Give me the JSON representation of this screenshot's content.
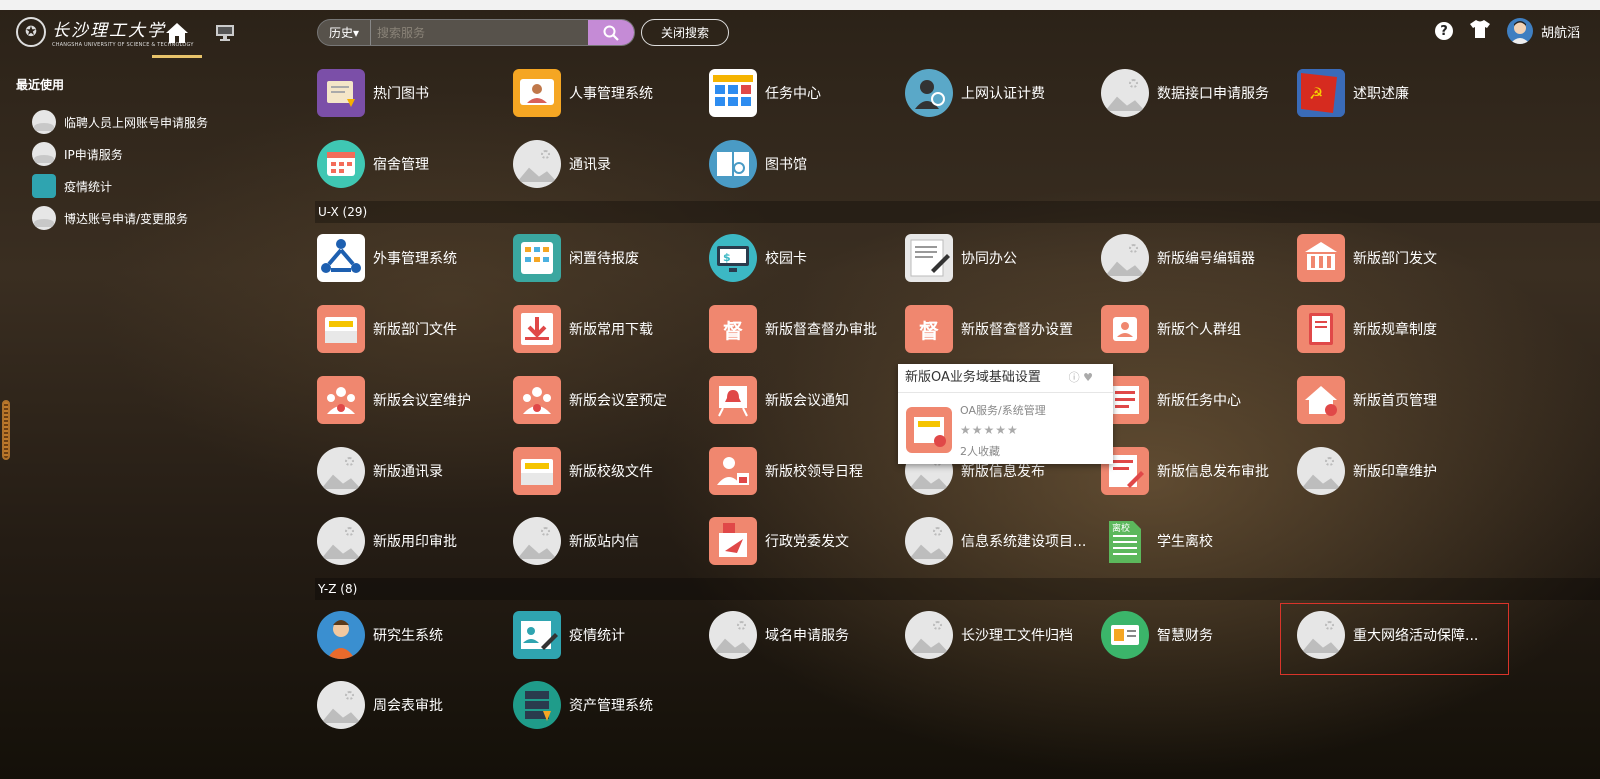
{
  "header": {
    "logo_cn": "长沙理工大学",
    "logo_en": "CHANGSHA UNIVERSITY OF SCIENCE & TECHNOLOGY",
    "history_label": "历史▾",
    "search_placeholder": "搜索服务",
    "close_search_label": "关闭搜索",
    "help_label": "?",
    "username": "胡航滔"
  },
  "sidebar": {
    "title": "最近使用",
    "items": [
      {
        "label": "临聘人员上网账号申请服务"
      },
      {
        "label": "IP申请服务"
      },
      {
        "label": "疫情统计"
      },
      {
        "label": "博达账号申请/变更服务"
      }
    ]
  },
  "sections": {
    "ux": "U-X (29)",
    "yz": "Y-Z (8)"
  },
  "apps": [
    {
      "label": "热门图书"
    },
    {
      "label": "人事管理系统"
    },
    {
      "label": "任务中心"
    },
    {
      "label": "上网认证计费"
    },
    {
      "label": "数据接口申请服务"
    },
    {
      "label": "述职述廉"
    },
    {
      "label": "宿舍管理"
    },
    {
      "label": "通讯录"
    },
    {
      "label": "图书馆"
    },
    {
      "label": "外事管理系统"
    },
    {
      "label": "闲置待报废"
    },
    {
      "label": "校园卡"
    },
    {
      "label": "协同办公"
    },
    {
      "label": "新版编号编辑器"
    },
    {
      "label": "新版部门发文"
    },
    {
      "label": "新版部门文件"
    },
    {
      "label": "新版常用下载"
    },
    {
      "label": "新版督查督办审批"
    },
    {
      "label": "新版督查督办设置"
    },
    {
      "label": "新版个人群组"
    },
    {
      "label": "新版规章制度"
    },
    {
      "label": "新版会议室维护"
    },
    {
      "label": "新版会议室预定"
    },
    {
      "label": "新版会议通知"
    },
    {
      "label": "新版任务中心"
    },
    {
      "label": "新版首页管理"
    },
    {
      "label": "新版通讯录"
    },
    {
      "label": "新版校级文件"
    },
    {
      "label": "新版校领导日程"
    },
    {
      "label": "新版信息发布"
    },
    {
      "label": "新版信息发布审批"
    },
    {
      "label": "新版印章维护"
    },
    {
      "label": "新版用印审批"
    },
    {
      "label": "新版站内信"
    },
    {
      "label": "行政党委发文"
    },
    {
      "label": "信息系统建设项目..."
    },
    {
      "label": "学生离校"
    },
    {
      "label": "研究生系统"
    },
    {
      "label": "疫情统计"
    },
    {
      "label": "域名申请服务"
    },
    {
      "label": "长沙理工文件归档"
    },
    {
      "label": "智慧财务"
    },
    {
      "label": "重大网络活动保障..."
    },
    {
      "label": "周会表审批"
    },
    {
      "label": "资产管理系统"
    }
  ],
  "tooltip": {
    "title": "新版OA业务域基础设置",
    "category": "OA服务/系统管理",
    "stars": "★★★★★",
    "favorites": "2人收藏"
  },
  "icon_glyphs": {
    "du": "督",
    "lixiao": "离校"
  }
}
